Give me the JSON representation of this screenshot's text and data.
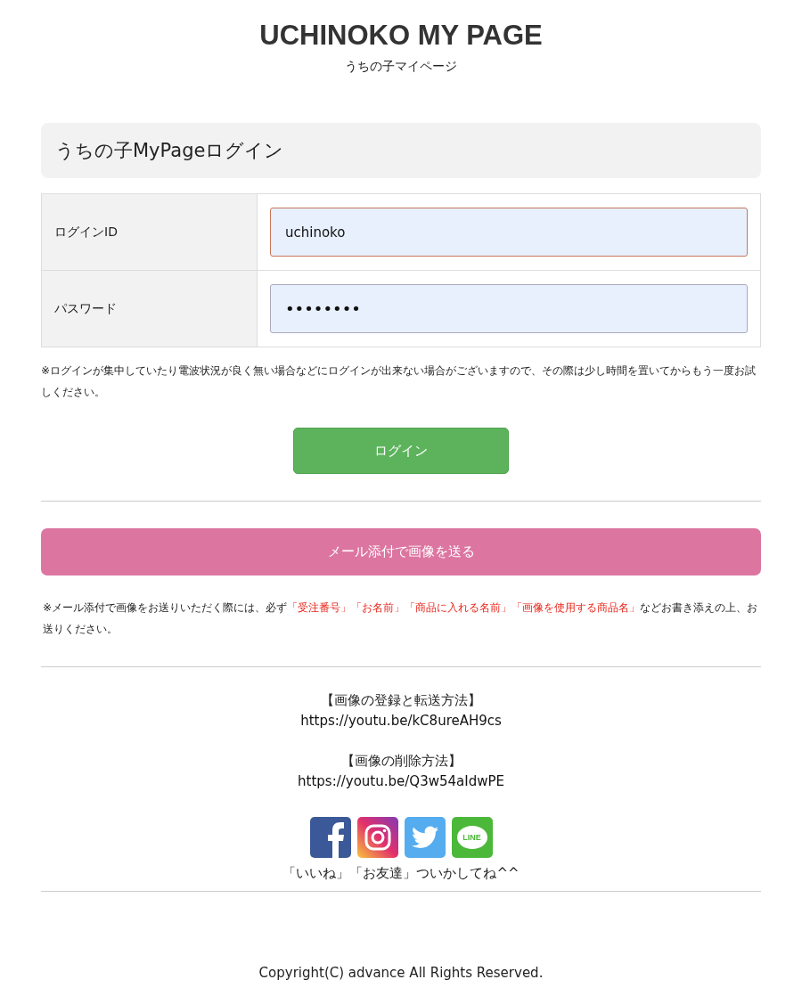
{
  "header": {
    "title": "UCHINOKO MY PAGE",
    "subtitle": "うちの子マイページ"
  },
  "login": {
    "heading": "うちの子MyPageログイン",
    "fields": [
      {
        "label": "ログインID",
        "kind": "text",
        "value": "uchinoko",
        "focused": true
      },
      {
        "label": "パスワード",
        "kind": "password",
        "value": "••••••••",
        "focused": false
      }
    ],
    "note": "※ログインが集中していたり電波状況が良く無い場合などにログインが出来ない場合がございますので、その際は少し時間を置いてからもう一度お試しください。",
    "button": "ログイン"
  },
  "mail": {
    "button": "メール添付で画像を送る",
    "note": [
      {
        "text": "※メール添付で画像をお送りいただく際には、必ず",
        "highlight": false
      },
      {
        "text": "「受注番号」「お名前」「商品に入れる名前」「画像を使用する商品名」",
        "highlight": true
      },
      {
        "text": "などお書き添えの上、お送りください。",
        "highlight": false
      }
    ]
  },
  "videos": [
    {
      "title": "【画像の登録と転送方法】",
      "url": "https://youtu.be/kC8ureAH9cs"
    },
    {
      "title": "【画像の削除方法】",
      "url": "https://youtu.be/Q3w54aIdwPE"
    }
  ],
  "social": {
    "icons": [
      {
        "kind": "facebook"
      },
      {
        "kind": "instagram"
      },
      {
        "kind": "twitter"
      },
      {
        "kind": "line",
        "label": "LINE"
      }
    ],
    "caption": "「いいね」「お友達」ついかしてね^^"
  },
  "footer": {
    "copyright": "Copyright(C) advance All Rights Reserved."
  }
}
